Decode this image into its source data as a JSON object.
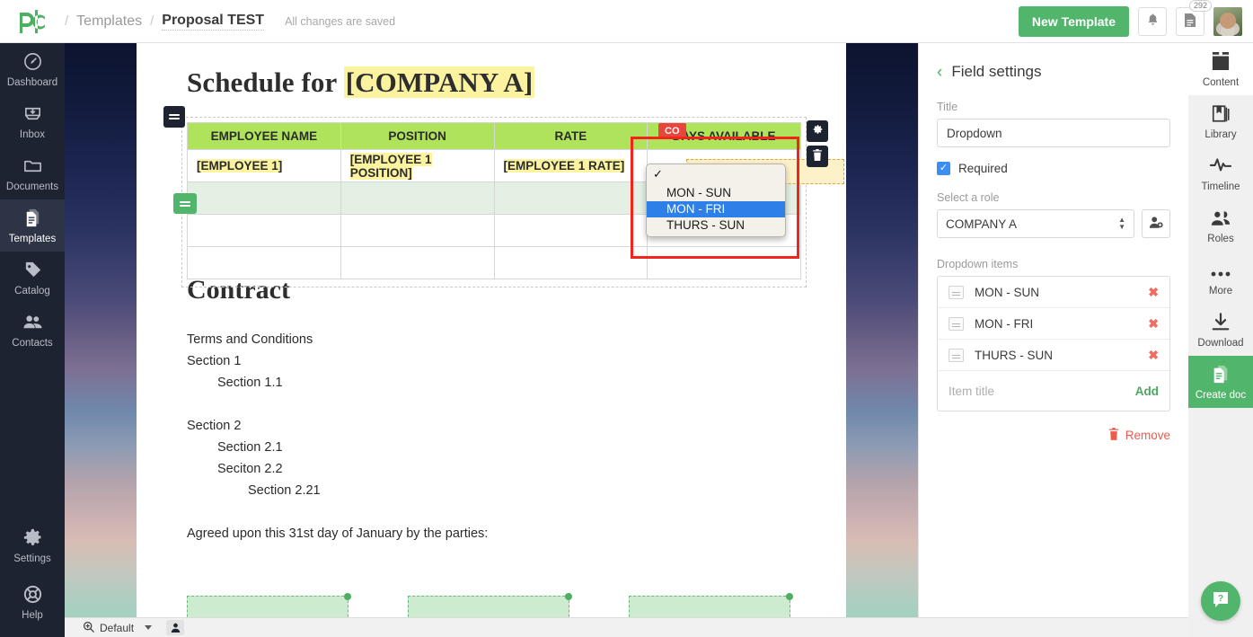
{
  "header": {
    "breadcrumb": {
      "sep": "/",
      "templates": "Templates",
      "current": "Proposal TEST"
    },
    "saved_note": "All changes are saved",
    "new_template_label": "New Template",
    "notifications_icon": "bell-icon",
    "docs_icon": "document-icon",
    "docs_badge": "292",
    "avatar_icon": "user-avatar"
  },
  "left_nav": {
    "items": [
      {
        "label": "Dashboard",
        "icon": "dashboard-icon",
        "active": false
      },
      {
        "label": "Inbox",
        "icon": "inbox-icon",
        "active": false
      },
      {
        "label": "Documents",
        "icon": "folder-icon",
        "active": false
      },
      {
        "label": "Templates",
        "icon": "templates-icon",
        "active": true
      },
      {
        "label": "Catalog",
        "icon": "tag-icon",
        "active": false
      },
      {
        "label": "Contacts",
        "icon": "contacts-icon",
        "active": false
      }
    ],
    "bottom": [
      {
        "label": "Settings",
        "icon": "gear-icon"
      },
      {
        "label": "Help",
        "icon": "lifebuoy-icon"
      }
    ]
  },
  "document": {
    "title_prefix": "Schedule for ",
    "title_token": "[COMPANY A]",
    "table": {
      "headers": [
        "EMPLOYEE NAME",
        "POSITION",
        "RATE",
        "DAYS AVAILABLE"
      ],
      "rows": [
        [
          "[EMPLOYEE 1]",
          "[EMPLOYEE 1 POSITION]",
          "[EMPLOYEE 1 RATE]",
          ""
        ],
        [
          "",
          "",
          "",
          ""
        ],
        [
          "",
          "",
          "",
          ""
        ],
        [
          "",
          "",
          "",
          ""
        ]
      ]
    },
    "tools": {
      "gear": "gear-icon",
      "trash": "trash-icon",
      "role_tag": "CO"
    },
    "heading2": "Contract",
    "body_lines": [
      {
        "text": "Terms and Conditions",
        "indent": 0
      },
      {
        "text": "Section 1",
        "indent": 0
      },
      {
        "text": "Section 1.1",
        "indent": 1
      },
      {
        "text": "",
        "indent": 0
      },
      {
        "text": "Section 2",
        "indent": 0
      },
      {
        "text": "Section 2.1",
        "indent": 1
      },
      {
        "text": "Seciton 2.2",
        "indent": 1
      },
      {
        "text": "Section 2.21",
        "indent": 2
      },
      {
        "text": "",
        "indent": 0
      },
      {
        "text": "Agreed upon this 31st day of January by the parties:",
        "indent": 0
      }
    ]
  },
  "select_popup": {
    "options": [
      "MON - SUN",
      "MON - FRI",
      "THURS - SUN"
    ],
    "selected_index": 1,
    "check_glyph": "✓"
  },
  "field_settings": {
    "back_icon": "chevron-left-icon",
    "panel_title": "Field settings",
    "title_label": "Title",
    "title_value": "Dropdown",
    "required_label": "Required",
    "required_checked": true,
    "role_label": "Select a role",
    "role_value": "COMPANY A",
    "add_role_icon": "add-user-icon",
    "dropdown_items_label": "Dropdown items",
    "dropdown_items": [
      "MON - SUN",
      "MON - FRI",
      "THURS - SUN"
    ],
    "add_placeholder": "Item title",
    "add_label": "Add",
    "remove_label": "Remove",
    "remove_icon": "trash-icon",
    "highlight_color": "#f5241b"
  },
  "right_rail": {
    "items": [
      {
        "label": "Content",
        "icon": "content-icon",
        "state": "active"
      },
      {
        "label": "Library",
        "icon": "library-icon",
        "state": "normal"
      },
      {
        "label": "Timeline",
        "icon": "timeline-icon",
        "state": "normal"
      },
      {
        "label": "Roles",
        "icon": "roles-icon",
        "state": "normal"
      },
      {
        "label": "More",
        "icon": "more-dots-icon",
        "state": "normal"
      },
      {
        "label": "Download",
        "icon": "download-icon",
        "state": "normal"
      },
      {
        "label": "Create doc",
        "icon": "create-doc-icon",
        "state": "green"
      }
    ],
    "help_fab_icon": "help-chat-icon"
  },
  "statusbar": {
    "zoom_icon": "zoom-icon",
    "zoom_label": "Default",
    "person_icon": "person-icon"
  }
}
